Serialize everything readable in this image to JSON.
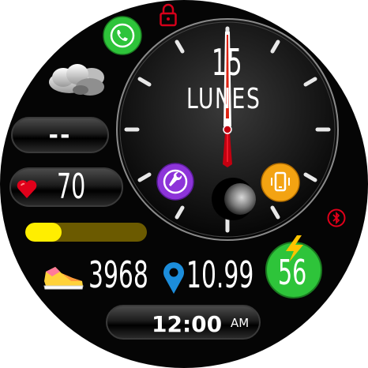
{
  "clock": {
    "day": "15",
    "weekday": "LUNES",
    "time": "12:00",
    "ampm": "AM"
  },
  "weather": {
    "value": "--",
    "icon": "cloud-icon"
  },
  "heart": {
    "value": "70",
    "icon": "heart-icon"
  },
  "progress": {
    "level": 0.3,
    "fill_color": "#ffee00",
    "track_color": "#6b5a00"
  },
  "steps": {
    "value": "3968",
    "icon": "sneaker-icon"
  },
  "distance": {
    "value": "10.99",
    "icon": "location-pin-icon"
  },
  "battery": {
    "value": "56",
    "icon": "lightning-bolt-icon"
  },
  "icons": {
    "phone": "phone-icon",
    "lock": "lock-icon",
    "settings": "wrench-icon",
    "mobile": "mobile-vibrate-icon",
    "moon": "moon-phase-icon",
    "bluetooth": "bluetooth-icon"
  },
  "colors": {
    "accent_green": "#2ec43a",
    "accent_red": "#e0001a",
    "accent_purple": "#8d34d9",
    "accent_orange": "#f3a312"
  }
}
